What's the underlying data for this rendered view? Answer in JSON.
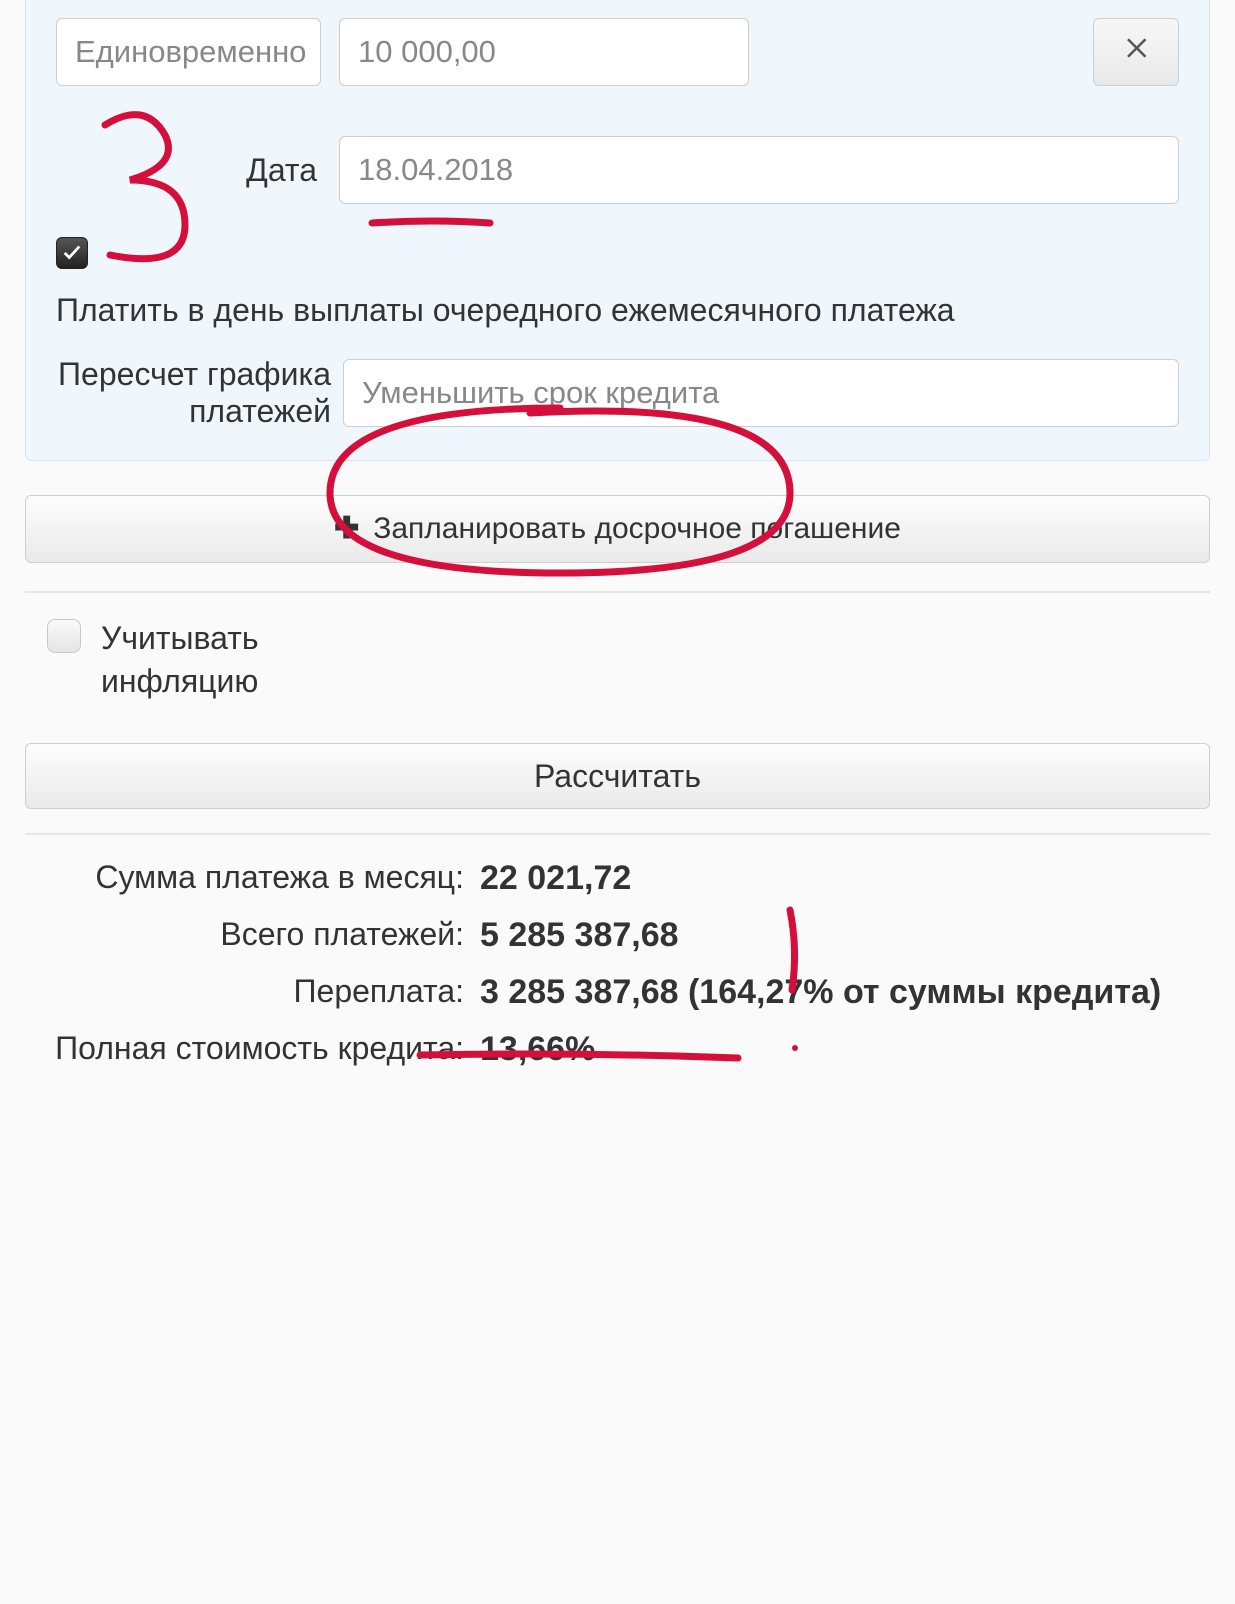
{
  "panel": {
    "type_value": "Единовременно",
    "amount_value": "10 000,00",
    "date_label": "Дата",
    "date_value": "18.04.2018",
    "pay_on_due_checked": true,
    "pay_on_due_label": "Платить в день выплаты очередного ежемесячного платежа",
    "recalc_label": "Пересчет графика платежей",
    "recalc_value": "Уменьшить срок кредита"
  },
  "plan_button_label": "Запланировать досрочное погашение",
  "inflation_label": "Учитывать инфляцию",
  "calc_button_label": "Рассчитать",
  "results": {
    "monthly_label": "Сумма платежа в месяц:",
    "monthly_value": "22 021,72",
    "total_label": "Всего платежей:",
    "total_value": "5 285 387,68",
    "overpay_label": "Переплата:",
    "overpay_value": "3 285 387,68 (164,27% от суммы кредита)",
    "fullcost_label": "Полная стоимость кредита:",
    "fullcost_value": "13,66%"
  },
  "annotations": {
    "number_three": "3",
    "color": "#d40f3c"
  }
}
